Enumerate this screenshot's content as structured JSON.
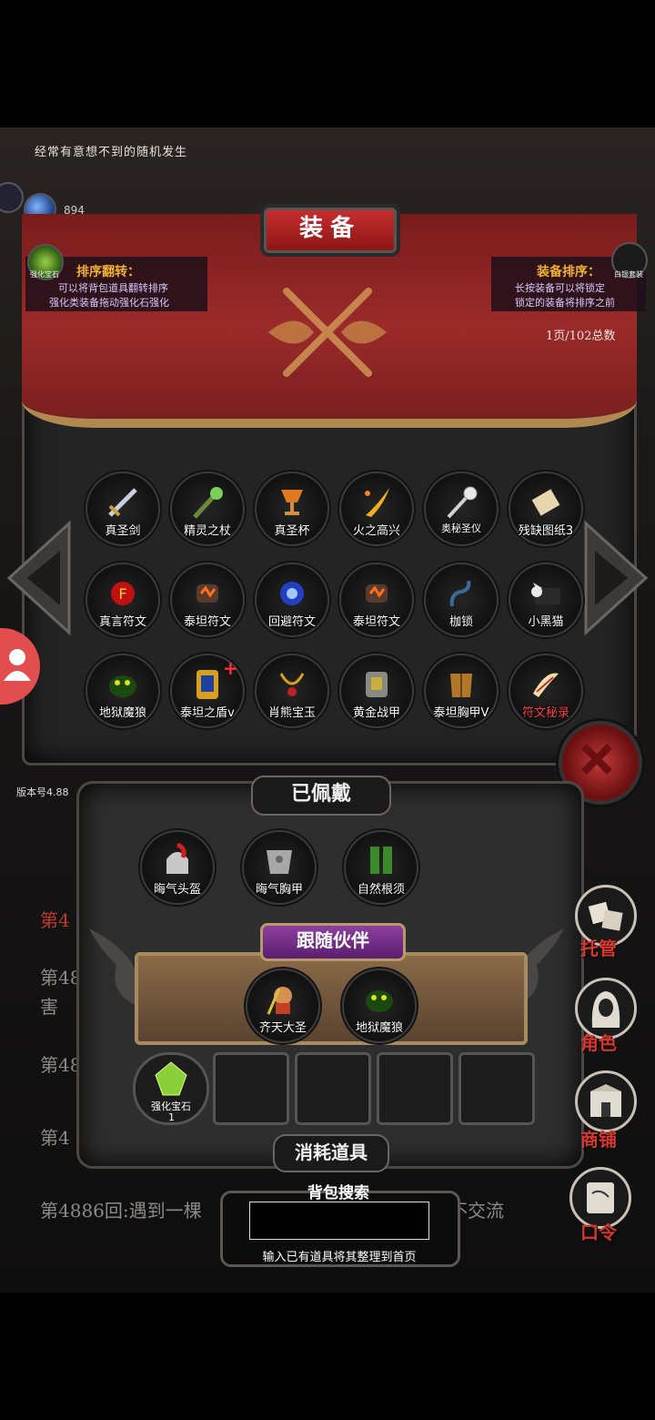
{
  "header_tip": "经常有意想不到的随机发生",
  "gem_count": "894",
  "gem_label": "宝石",
  "version": "版本号4.88",
  "panel_title": "装备",
  "hint_left": {
    "title": "排序翻转：",
    "lines": [
      "可以将背包道具翻转排序",
      "强化类装备拖动强化石强化"
    ]
  },
  "hint_right": {
    "title": "装备排序：",
    "lines": [
      "长按装备可以将锁定",
      "锁定的装备将排序之前"
    ]
  },
  "side_left_label": "强化宝石",
  "side_right_label": "白银套装",
  "page_info": "1页/102总数",
  "items": [
    {
      "label": "真圣剑",
      "icon": "sword-icon"
    },
    {
      "label": "精灵之杖",
      "icon": "staff-icon"
    },
    {
      "label": "真圣杯",
      "icon": "grail-icon"
    },
    {
      "label": "火之高兴",
      "icon": "flame-blade-icon"
    },
    {
      "label": "奥秘圣仪",
      "icon": "mace-icon"
    },
    {
      "label": "残缺图纸3",
      "icon": "scroll-icon"
    },
    {
      "label": "真言符文",
      "icon": "red-rune-icon"
    },
    {
      "label": "泰坦符文",
      "icon": "titan-rune-icon"
    },
    {
      "label": "回避符文",
      "icon": "blue-rune-icon"
    },
    {
      "label": "泰坦符文",
      "icon": "titan-rune-icon"
    },
    {
      "label": "枷锁",
      "icon": "chain-icon"
    },
    {
      "label": "小黑猫",
      "icon": "cat-icon"
    },
    {
      "label": "地狱魔狼",
      "icon": "wolf-icon"
    },
    {
      "label": "泰坦之盾v",
      "icon": "shield-icon"
    },
    {
      "label": "肖熊宝玉",
      "icon": "amulet-icon"
    },
    {
      "label": "黄金战甲",
      "icon": "gold-armor-icon"
    },
    {
      "label": "泰坦胸甲V",
      "icon": "breastplate-icon"
    },
    {
      "label": "符文秘录",
      "icon": "horn-scroll-icon",
      "red": true
    }
  ],
  "worn_title": "已佩戴",
  "worn_items": [
    "晦气头盔",
    "晦气胸甲",
    "自然根须"
  ],
  "follow_title": "跟随伙伴",
  "companions": [
    "齐天大圣",
    "地狱魔狼"
  ],
  "consumable_first": {
    "label": "强化宝石",
    "count": "1"
  },
  "consumable_title": "消耗道具",
  "search_title": "背包搜索",
  "search_hint": "输入已有道具将其整理到首页",
  "search_value": "",
  "log_lines": [
    "第4",
    "第488",
    "害",
    "第48",
    "第4",
    "第4886回:遇到一棵",
    "不交流"
  ],
  "menu": [
    "托管",
    "角色",
    "商铺",
    "口令"
  ],
  "colors": {
    "banner": "#9b2a2a",
    "gold": "#f0b030",
    "menu_red": "#d8372f"
  }
}
